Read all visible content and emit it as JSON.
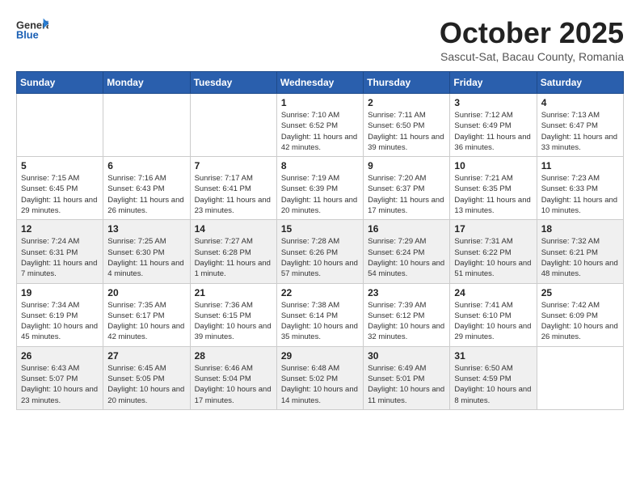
{
  "logo": {
    "general": "General",
    "blue": "Blue"
  },
  "title": "October 2025",
  "subtitle": "Sascut-Sat, Bacau County, Romania",
  "days_of_week": [
    "Sunday",
    "Monday",
    "Tuesday",
    "Wednesday",
    "Thursday",
    "Friday",
    "Saturday"
  ],
  "weeks": [
    {
      "days": [
        {
          "num": "",
          "info": ""
        },
        {
          "num": "",
          "info": ""
        },
        {
          "num": "",
          "info": ""
        },
        {
          "num": "1",
          "info": "Sunrise: 7:10 AM\nSunset: 6:52 PM\nDaylight: 11 hours and 42 minutes."
        },
        {
          "num": "2",
          "info": "Sunrise: 7:11 AM\nSunset: 6:50 PM\nDaylight: 11 hours and 39 minutes."
        },
        {
          "num": "3",
          "info": "Sunrise: 7:12 AM\nSunset: 6:49 PM\nDaylight: 11 hours and 36 minutes."
        },
        {
          "num": "4",
          "info": "Sunrise: 7:13 AM\nSunset: 6:47 PM\nDaylight: 11 hours and 33 minutes."
        }
      ]
    },
    {
      "days": [
        {
          "num": "5",
          "info": "Sunrise: 7:15 AM\nSunset: 6:45 PM\nDaylight: 11 hours and 29 minutes."
        },
        {
          "num": "6",
          "info": "Sunrise: 7:16 AM\nSunset: 6:43 PM\nDaylight: 11 hours and 26 minutes."
        },
        {
          "num": "7",
          "info": "Sunrise: 7:17 AM\nSunset: 6:41 PM\nDaylight: 11 hours and 23 minutes."
        },
        {
          "num": "8",
          "info": "Sunrise: 7:19 AM\nSunset: 6:39 PM\nDaylight: 11 hours and 20 minutes."
        },
        {
          "num": "9",
          "info": "Sunrise: 7:20 AM\nSunset: 6:37 PM\nDaylight: 11 hours and 17 minutes."
        },
        {
          "num": "10",
          "info": "Sunrise: 7:21 AM\nSunset: 6:35 PM\nDaylight: 11 hours and 13 minutes."
        },
        {
          "num": "11",
          "info": "Sunrise: 7:23 AM\nSunset: 6:33 PM\nDaylight: 11 hours and 10 minutes."
        }
      ]
    },
    {
      "days": [
        {
          "num": "12",
          "info": "Sunrise: 7:24 AM\nSunset: 6:31 PM\nDaylight: 11 hours and 7 minutes."
        },
        {
          "num": "13",
          "info": "Sunrise: 7:25 AM\nSunset: 6:30 PM\nDaylight: 11 hours and 4 minutes."
        },
        {
          "num": "14",
          "info": "Sunrise: 7:27 AM\nSunset: 6:28 PM\nDaylight: 11 hours and 1 minute."
        },
        {
          "num": "15",
          "info": "Sunrise: 7:28 AM\nSunset: 6:26 PM\nDaylight: 10 hours and 57 minutes."
        },
        {
          "num": "16",
          "info": "Sunrise: 7:29 AM\nSunset: 6:24 PM\nDaylight: 10 hours and 54 minutes."
        },
        {
          "num": "17",
          "info": "Sunrise: 7:31 AM\nSunset: 6:22 PM\nDaylight: 10 hours and 51 minutes."
        },
        {
          "num": "18",
          "info": "Sunrise: 7:32 AM\nSunset: 6:21 PM\nDaylight: 10 hours and 48 minutes."
        }
      ]
    },
    {
      "days": [
        {
          "num": "19",
          "info": "Sunrise: 7:34 AM\nSunset: 6:19 PM\nDaylight: 10 hours and 45 minutes."
        },
        {
          "num": "20",
          "info": "Sunrise: 7:35 AM\nSunset: 6:17 PM\nDaylight: 10 hours and 42 minutes."
        },
        {
          "num": "21",
          "info": "Sunrise: 7:36 AM\nSunset: 6:15 PM\nDaylight: 10 hours and 39 minutes."
        },
        {
          "num": "22",
          "info": "Sunrise: 7:38 AM\nSunset: 6:14 PM\nDaylight: 10 hours and 35 minutes."
        },
        {
          "num": "23",
          "info": "Sunrise: 7:39 AM\nSunset: 6:12 PM\nDaylight: 10 hours and 32 minutes."
        },
        {
          "num": "24",
          "info": "Sunrise: 7:41 AM\nSunset: 6:10 PM\nDaylight: 10 hours and 29 minutes."
        },
        {
          "num": "25",
          "info": "Sunrise: 7:42 AM\nSunset: 6:09 PM\nDaylight: 10 hours and 26 minutes."
        }
      ]
    },
    {
      "days": [
        {
          "num": "26",
          "info": "Sunrise: 6:43 AM\nSunset: 5:07 PM\nDaylight: 10 hours and 23 minutes."
        },
        {
          "num": "27",
          "info": "Sunrise: 6:45 AM\nSunset: 5:05 PM\nDaylight: 10 hours and 20 minutes."
        },
        {
          "num": "28",
          "info": "Sunrise: 6:46 AM\nSunset: 5:04 PM\nDaylight: 10 hours and 17 minutes."
        },
        {
          "num": "29",
          "info": "Sunrise: 6:48 AM\nSunset: 5:02 PM\nDaylight: 10 hours and 14 minutes."
        },
        {
          "num": "30",
          "info": "Sunrise: 6:49 AM\nSunset: 5:01 PM\nDaylight: 10 hours and 11 minutes."
        },
        {
          "num": "31",
          "info": "Sunrise: 6:50 AM\nSunset: 4:59 PM\nDaylight: 10 hours and 8 minutes."
        },
        {
          "num": "",
          "info": ""
        }
      ]
    }
  ]
}
